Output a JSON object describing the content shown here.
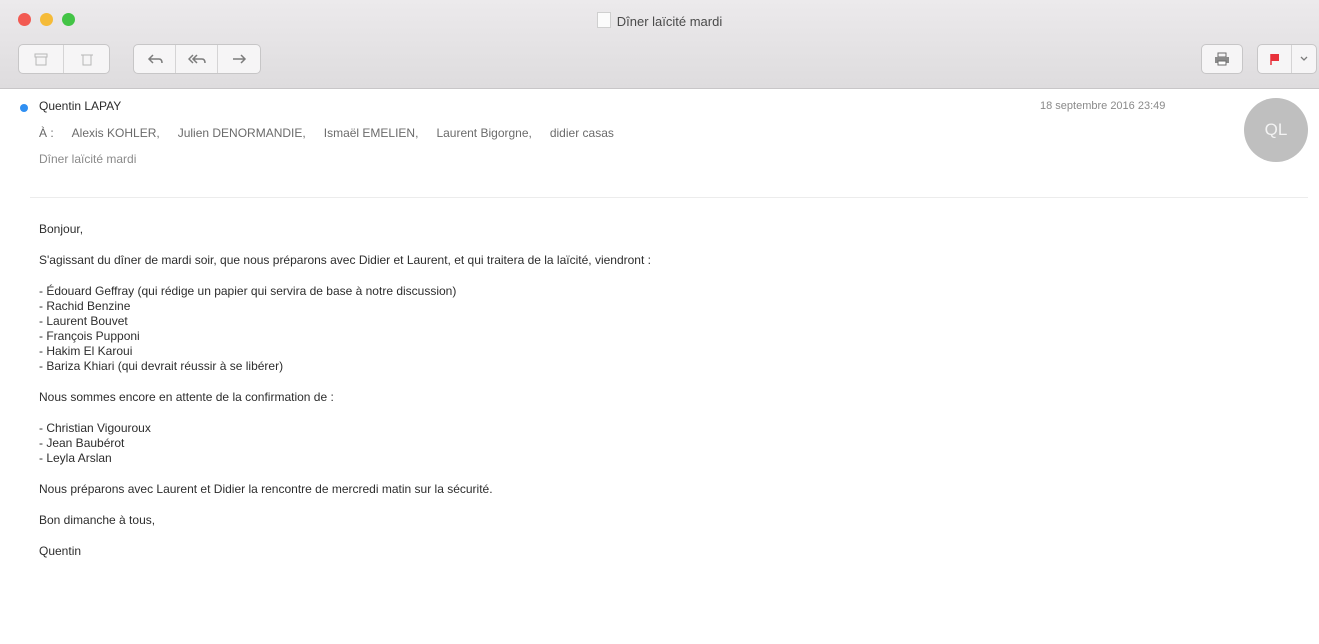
{
  "window": {
    "title": "Dîner laïcité mardi"
  },
  "toolbar": {
    "archive_icon": "archive-icon",
    "trash_icon": "trash-icon",
    "reply_label": "⟲",
    "reply_all_label": "⟲⟲",
    "forward_label": "➜",
    "print_label": "🖶",
    "flag_label": "⚑",
    "flag_menu_label": "⌄",
    "flag_color": "#e8313a"
  },
  "message": {
    "sender": "Quentin LAPAY",
    "date": "18 septembre 2016 23:49",
    "avatar_initials": "QL",
    "to_label": "À :",
    "recipients": [
      "Alexis KOHLER,",
      "Julien DENORMANDIE,",
      "Ismaël EMELIEN,",
      "Laurent Bigorgne,",
      "didier casas"
    ],
    "subject": "Dîner laïcité mardi"
  },
  "body": {
    "greeting": "Bonjour,",
    "intro": "S'agissant du dîner de mardi soir, que nous préparons avec Didier et Laurent, et qui traitera de la laïcité, viendront :",
    "attendees": [
      "- Édouard Geffray (qui rédige un papier qui servira de base à notre discussion)",
      "- Rachid Benzine",
      "- Laurent Bouvet",
      "- François Pupponi",
      "- Hakim El Karoui",
      "- Bariza Khiari (qui devrait réussir à se libérer)"
    ],
    "pending_intro": "Nous sommes encore en attente de la confirmation de :",
    "pending": [
      "- Christian Vigouroux",
      "- Jean Baubérot",
      "- Leyla Arslan"
    ],
    "meeting": "Nous préparons avec Laurent et Didier la rencontre de mercredi matin sur la sécurité.",
    "closing": "Bon dimanche à tous,",
    "signature": "Quentin"
  }
}
